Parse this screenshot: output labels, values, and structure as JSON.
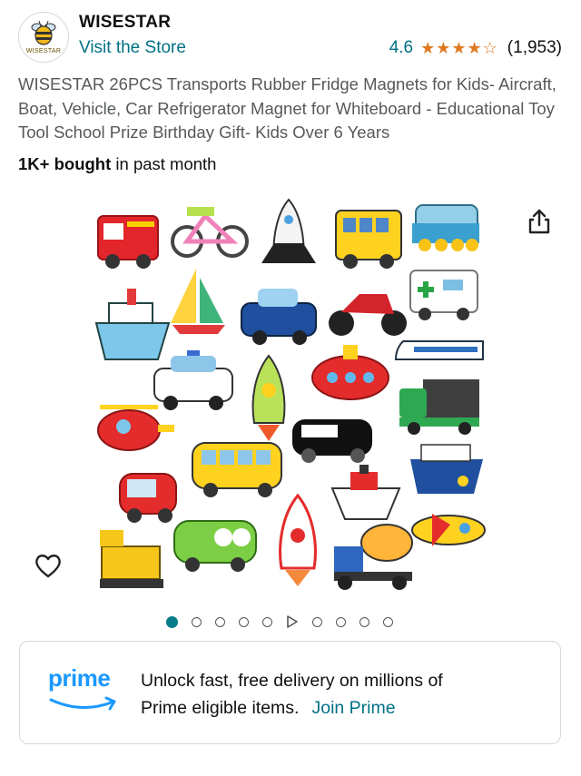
{
  "brand": {
    "name": "WISESTAR",
    "logo_text": "WISESTAR",
    "store_link": "Visit the Store"
  },
  "rating": {
    "value": "4.6",
    "stars": 4.5,
    "count": "(1,953)"
  },
  "product": {
    "title": "WISESTAR 26PCS Transports Rubber Fridge Magnets for Kids- Aircraft, Boat, Vehicle, Car Refrigerator Magnet for Whiteboard - Educational Toy Tool School Prize Birthday Gift- Kids Over 6 Years",
    "bought_bold": "1K+ bought",
    "bought_rest": " in past month",
    "image_alt": "Transport magnet set: fire truck, bicycle, space shuttle, school bus, train, ship, sailboat, taxi, motorcycle, ambulance, bullet train, police car, rocket, submarine, truck, helicopter, bus, car, ferry, excavator, classic car, cement mixer, airplane"
  },
  "gallery": {
    "slides": 9,
    "active_index": 0,
    "video_index": 5
  },
  "icons": {
    "share": "share-icon",
    "favorite": "heart-icon",
    "prime": "prime-logo"
  },
  "prime": {
    "logo_word": "prime",
    "line1": "Unlock fast, free delivery on millions of",
    "line2": "Prime eligible items.",
    "join": "Join Prime"
  },
  "colors": {
    "link": "#007185",
    "star": "#de7921",
    "prime_blue": "#1a98ff",
    "pager_active": "#087b8b"
  }
}
